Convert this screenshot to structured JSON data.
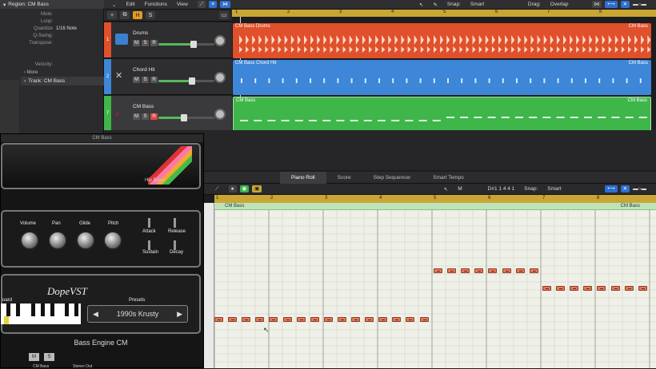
{
  "inspector": {
    "region_label": "Region:",
    "region_name": "CM Bass",
    "rows": [
      {
        "k": "Mute:",
        "v": ""
      },
      {
        "k": "Loop:",
        "v": ""
      },
      {
        "k": "Quantize",
        "v": "1/16 Note"
      },
      {
        "k": "Q-Swing:",
        "v": ""
      },
      {
        "k": "Transpose:",
        "v": ""
      },
      {
        "k": "Velocity:",
        "v": ""
      }
    ],
    "more_label": "More",
    "track_label": "Track:",
    "track_name": "CM Bass"
  },
  "toolbar": {
    "edit": "Edit",
    "functions": "Functions",
    "view": "View",
    "snap_label": "Snap:",
    "snap_value": "Smart",
    "drag_label": "Drag:",
    "drag_value": "Overlap",
    "h_btn": "H",
    "s_btn": "S",
    "add_btn": "+"
  },
  "ruler_marks": [
    "1",
    "2",
    "3",
    "4",
    "5",
    "6",
    "7",
    "8"
  ],
  "tracks": [
    {
      "num": "1",
      "name": "Drums",
      "color": "#e0502a",
      "region": "CM Bass Drums",
      "region_right": "CM Bass",
      "volume": 0.62,
      "rec": false
    },
    {
      "num": "2",
      "name": "Chord Hit",
      "color": "#3d86d8",
      "region": "CM Bass Chord Hit",
      "region_right": "CM Bass",
      "volume": 0.6,
      "rec": false
    },
    {
      "num": "7",
      "name": "CM Bass",
      "color": "#3fb64a",
      "region": "CM Bass",
      "region_right": "CM Bass",
      "volume": 0.45,
      "rec": true
    }
  ],
  "plugin": {
    "window_title": "CM Bass",
    "amp_label": "Hip Bass",
    "knobs": [
      "Volume",
      "Pan",
      "Glide",
      "Pitch"
    ],
    "adsr": [
      "Attack",
      "Release",
      "Sustain",
      "Decay"
    ],
    "logo": "DopeVST",
    "keyboard_label": "oard",
    "presets_label": "Presets",
    "preset_value": "1990s Krusty",
    "product_name": "Bass Engine CM",
    "bottom_buttons": [
      "M",
      "S"
    ],
    "bottom_track": "CM Bass",
    "bottom_right": "Stereo Out"
  },
  "editor": {
    "tabs": [
      "Piano Roll",
      "Score",
      "Step Sequencer",
      "Smart Tempo"
    ],
    "active_tab": "Piano Roll",
    "position": "D#1  1 4 4 1",
    "snap_label": "Snap:",
    "snap_value": "Smart",
    "region_name": "CM Bass",
    "ruler_marks": [
      "1",
      "2",
      "3",
      "4",
      "5",
      "6",
      "7",
      "8"
    ],
    "note_color": "#e8775a"
  }
}
